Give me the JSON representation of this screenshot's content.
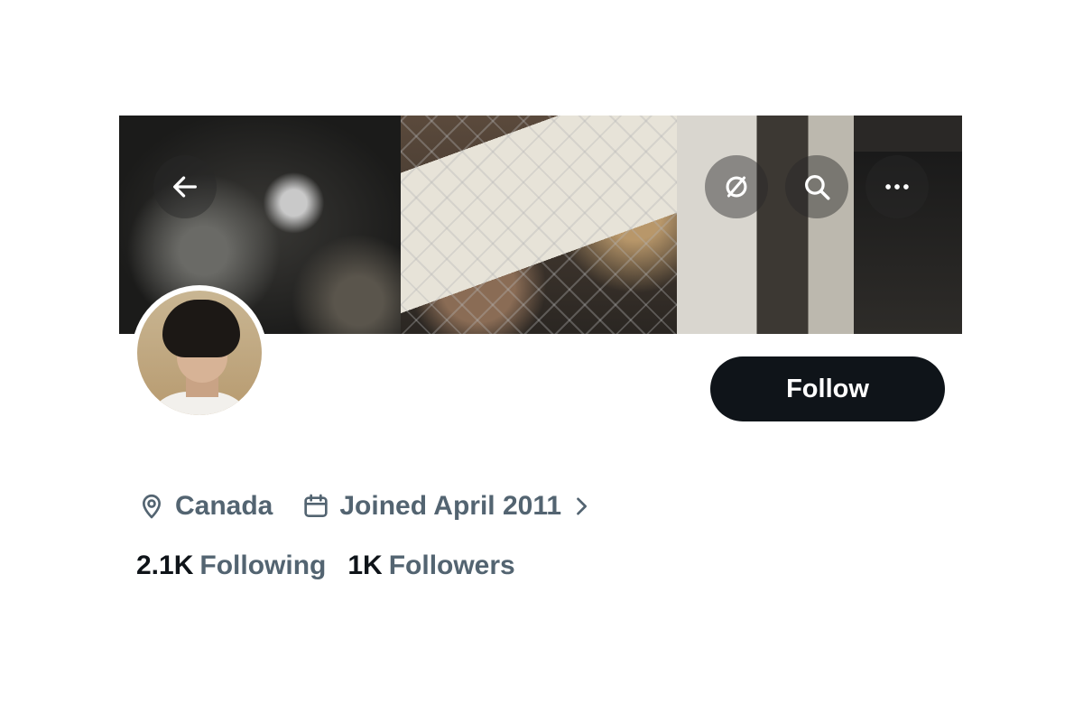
{
  "header": {
    "back_icon": "arrow-left-icon",
    "buttons": [
      {
        "icon": "no-translate-icon"
      },
      {
        "icon": "search-icon"
      },
      {
        "icon": "more-icon"
      }
    ]
  },
  "profile": {
    "follow_label": "Follow",
    "location": "Canada",
    "joined": "Joined April 2011",
    "following_count": "2.1K",
    "following_label": "Following",
    "followers_count": "1K",
    "followers_label": "Followers"
  },
  "colors": {
    "text_primary": "#0f1419",
    "text_secondary": "#536471",
    "button_bg": "#0f1419"
  }
}
